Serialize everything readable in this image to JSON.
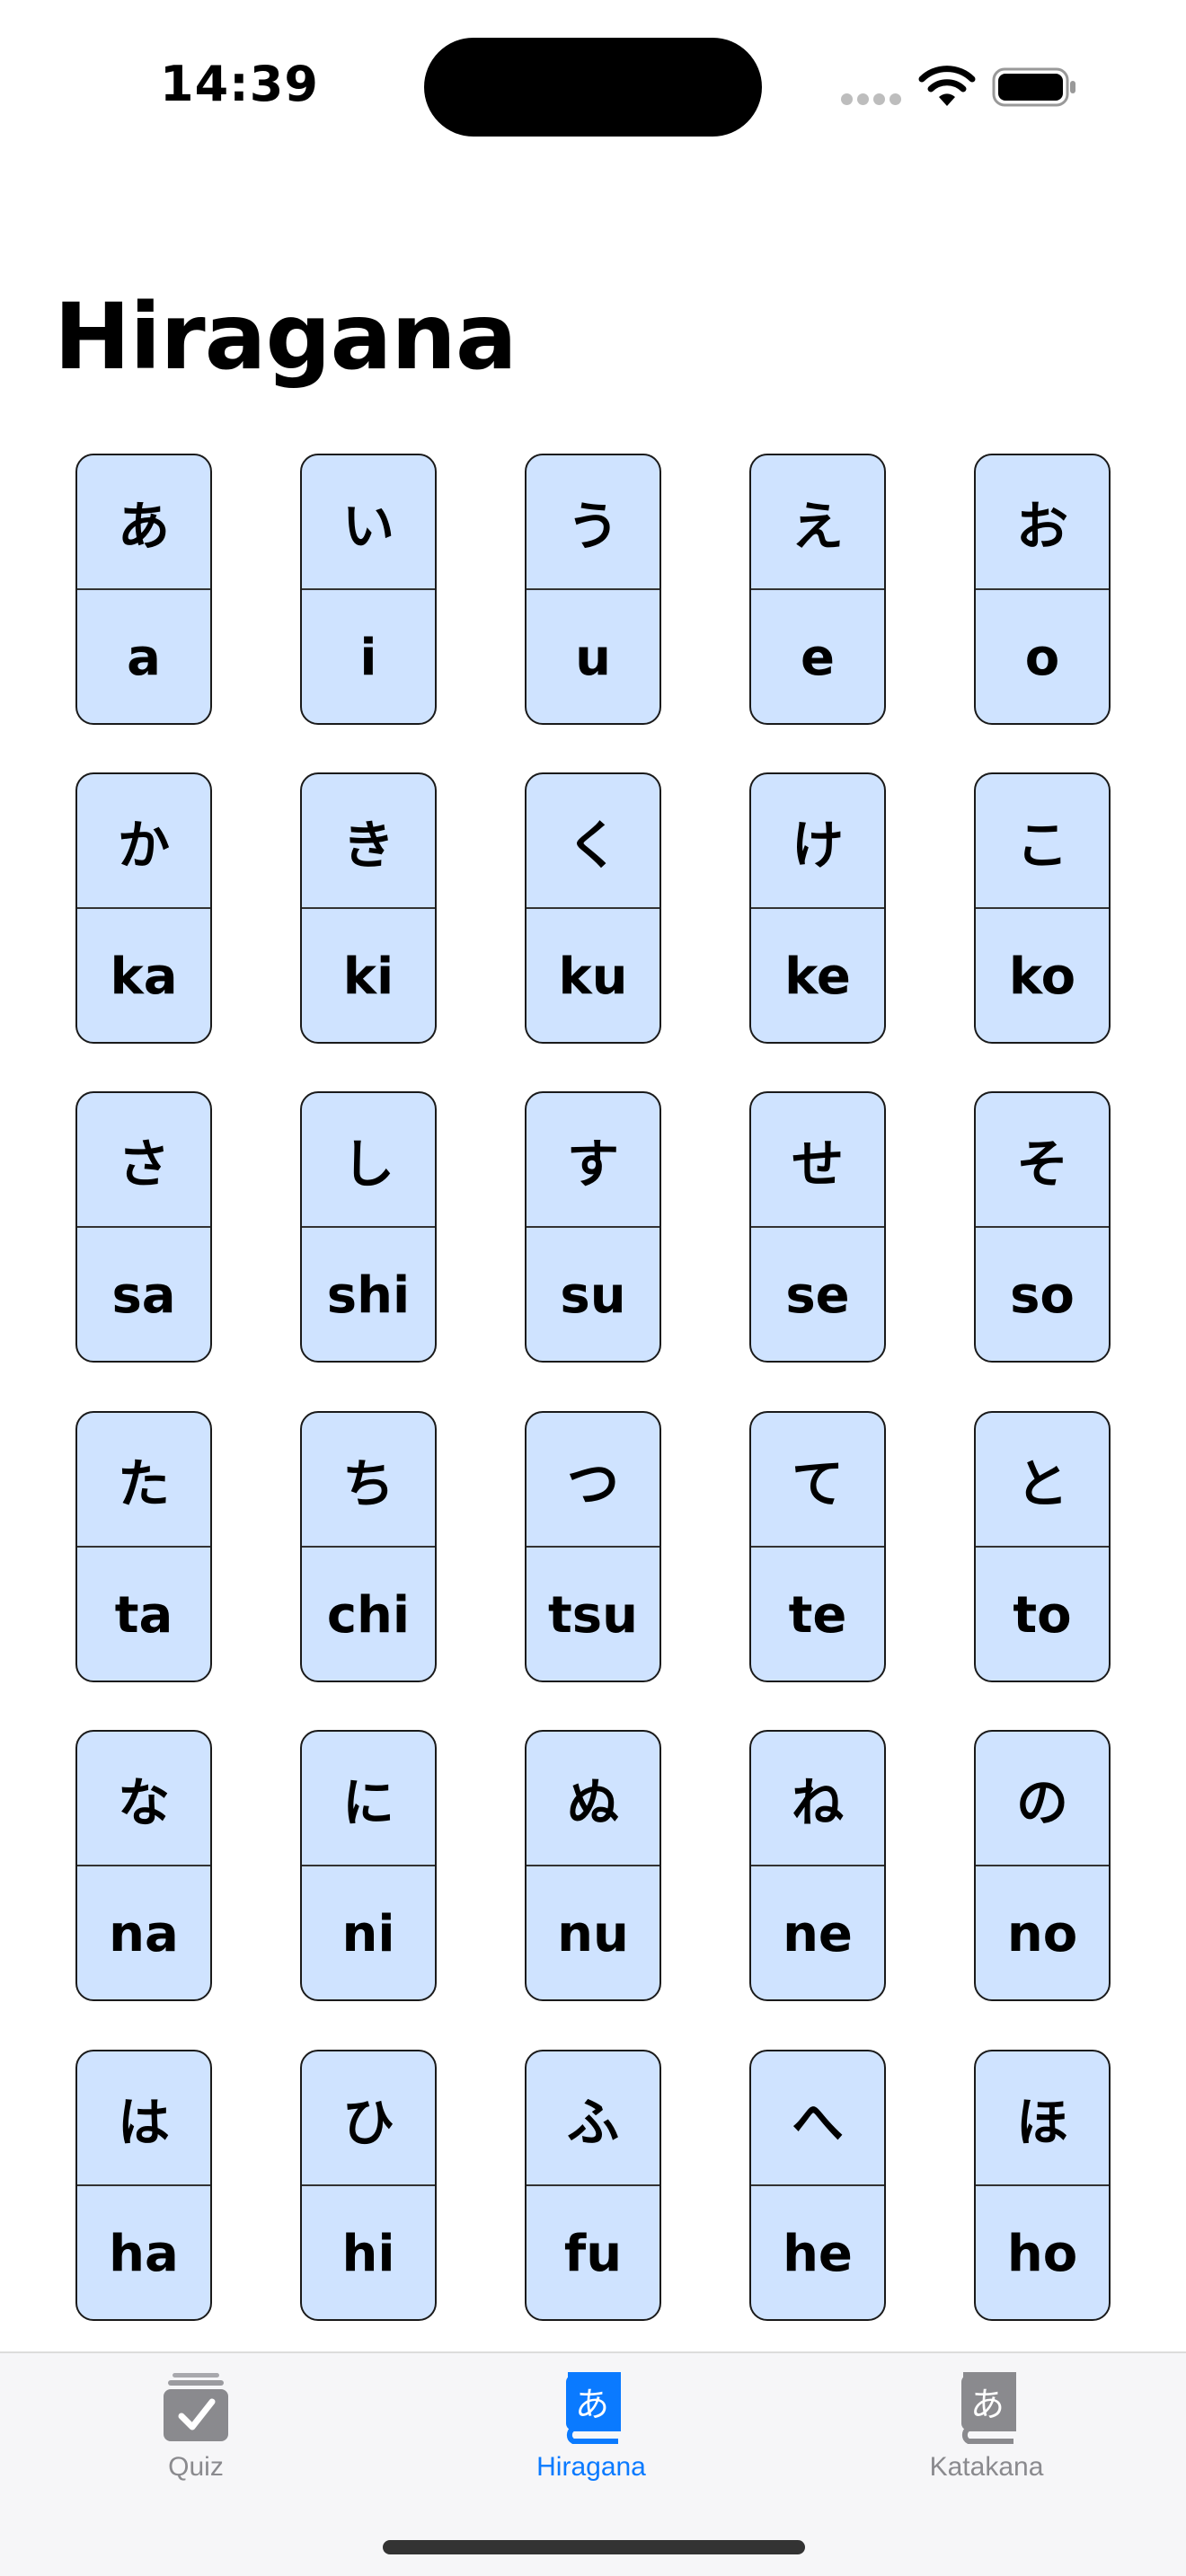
{
  "status_bar": {
    "time": "14:39"
  },
  "page": {
    "title": "Hiragana"
  },
  "kana_rows": [
    [
      {
        "char": "あ",
        "romaji": "a"
      },
      {
        "char": "い",
        "romaji": "i"
      },
      {
        "char": "う",
        "romaji": "u"
      },
      {
        "char": "え",
        "romaji": "e"
      },
      {
        "char": "お",
        "romaji": "o"
      }
    ],
    [
      {
        "char": "か",
        "romaji": "ka"
      },
      {
        "char": "き",
        "romaji": "ki"
      },
      {
        "char": "く",
        "romaji": "ku"
      },
      {
        "char": "け",
        "romaji": "ke"
      },
      {
        "char": "こ",
        "romaji": "ko"
      }
    ],
    [
      {
        "char": "さ",
        "romaji": "sa"
      },
      {
        "char": "し",
        "romaji": "shi"
      },
      {
        "char": "す",
        "romaji": "su"
      },
      {
        "char": "せ",
        "romaji": "se"
      },
      {
        "char": "そ",
        "romaji": "so"
      }
    ],
    [
      {
        "char": "た",
        "romaji": "ta"
      },
      {
        "char": "ち",
        "romaji": "chi"
      },
      {
        "char": "つ",
        "romaji": "tsu"
      },
      {
        "char": "て",
        "romaji": "te"
      },
      {
        "char": "と",
        "romaji": "to"
      }
    ],
    [
      {
        "char": "な",
        "romaji": "na"
      },
      {
        "char": "に",
        "romaji": "ni"
      },
      {
        "char": "ぬ",
        "romaji": "nu"
      },
      {
        "char": "ね",
        "romaji": "ne"
      },
      {
        "char": "の",
        "romaji": "no"
      }
    ],
    [
      {
        "char": "は",
        "romaji": "ha"
      },
      {
        "char": "ひ",
        "romaji": "hi"
      },
      {
        "char": "ふ",
        "romaji": "fu"
      },
      {
        "char": "へ",
        "romaji": "he"
      },
      {
        "char": "ほ",
        "romaji": "ho"
      }
    ]
  ],
  "tab_bar": {
    "tabs": [
      {
        "label": "Quiz",
        "icon": "checkmark-stack-icon",
        "active": false
      },
      {
        "label": "Hiragana",
        "icon": "hiragana-book-icon",
        "glyph": "あ",
        "active": true
      },
      {
        "label": "Katakana",
        "icon": "katakana-book-icon",
        "glyph": "あ",
        "active": false
      }
    ]
  },
  "colors": {
    "accent": "#0a7aff",
    "card_fill": "#cfe3ff",
    "card_border": "#1a1a1a",
    "inactive_tab": "#8a8a8e",
    "tab_bar_bg": "#f6f6f8"
  }
}
